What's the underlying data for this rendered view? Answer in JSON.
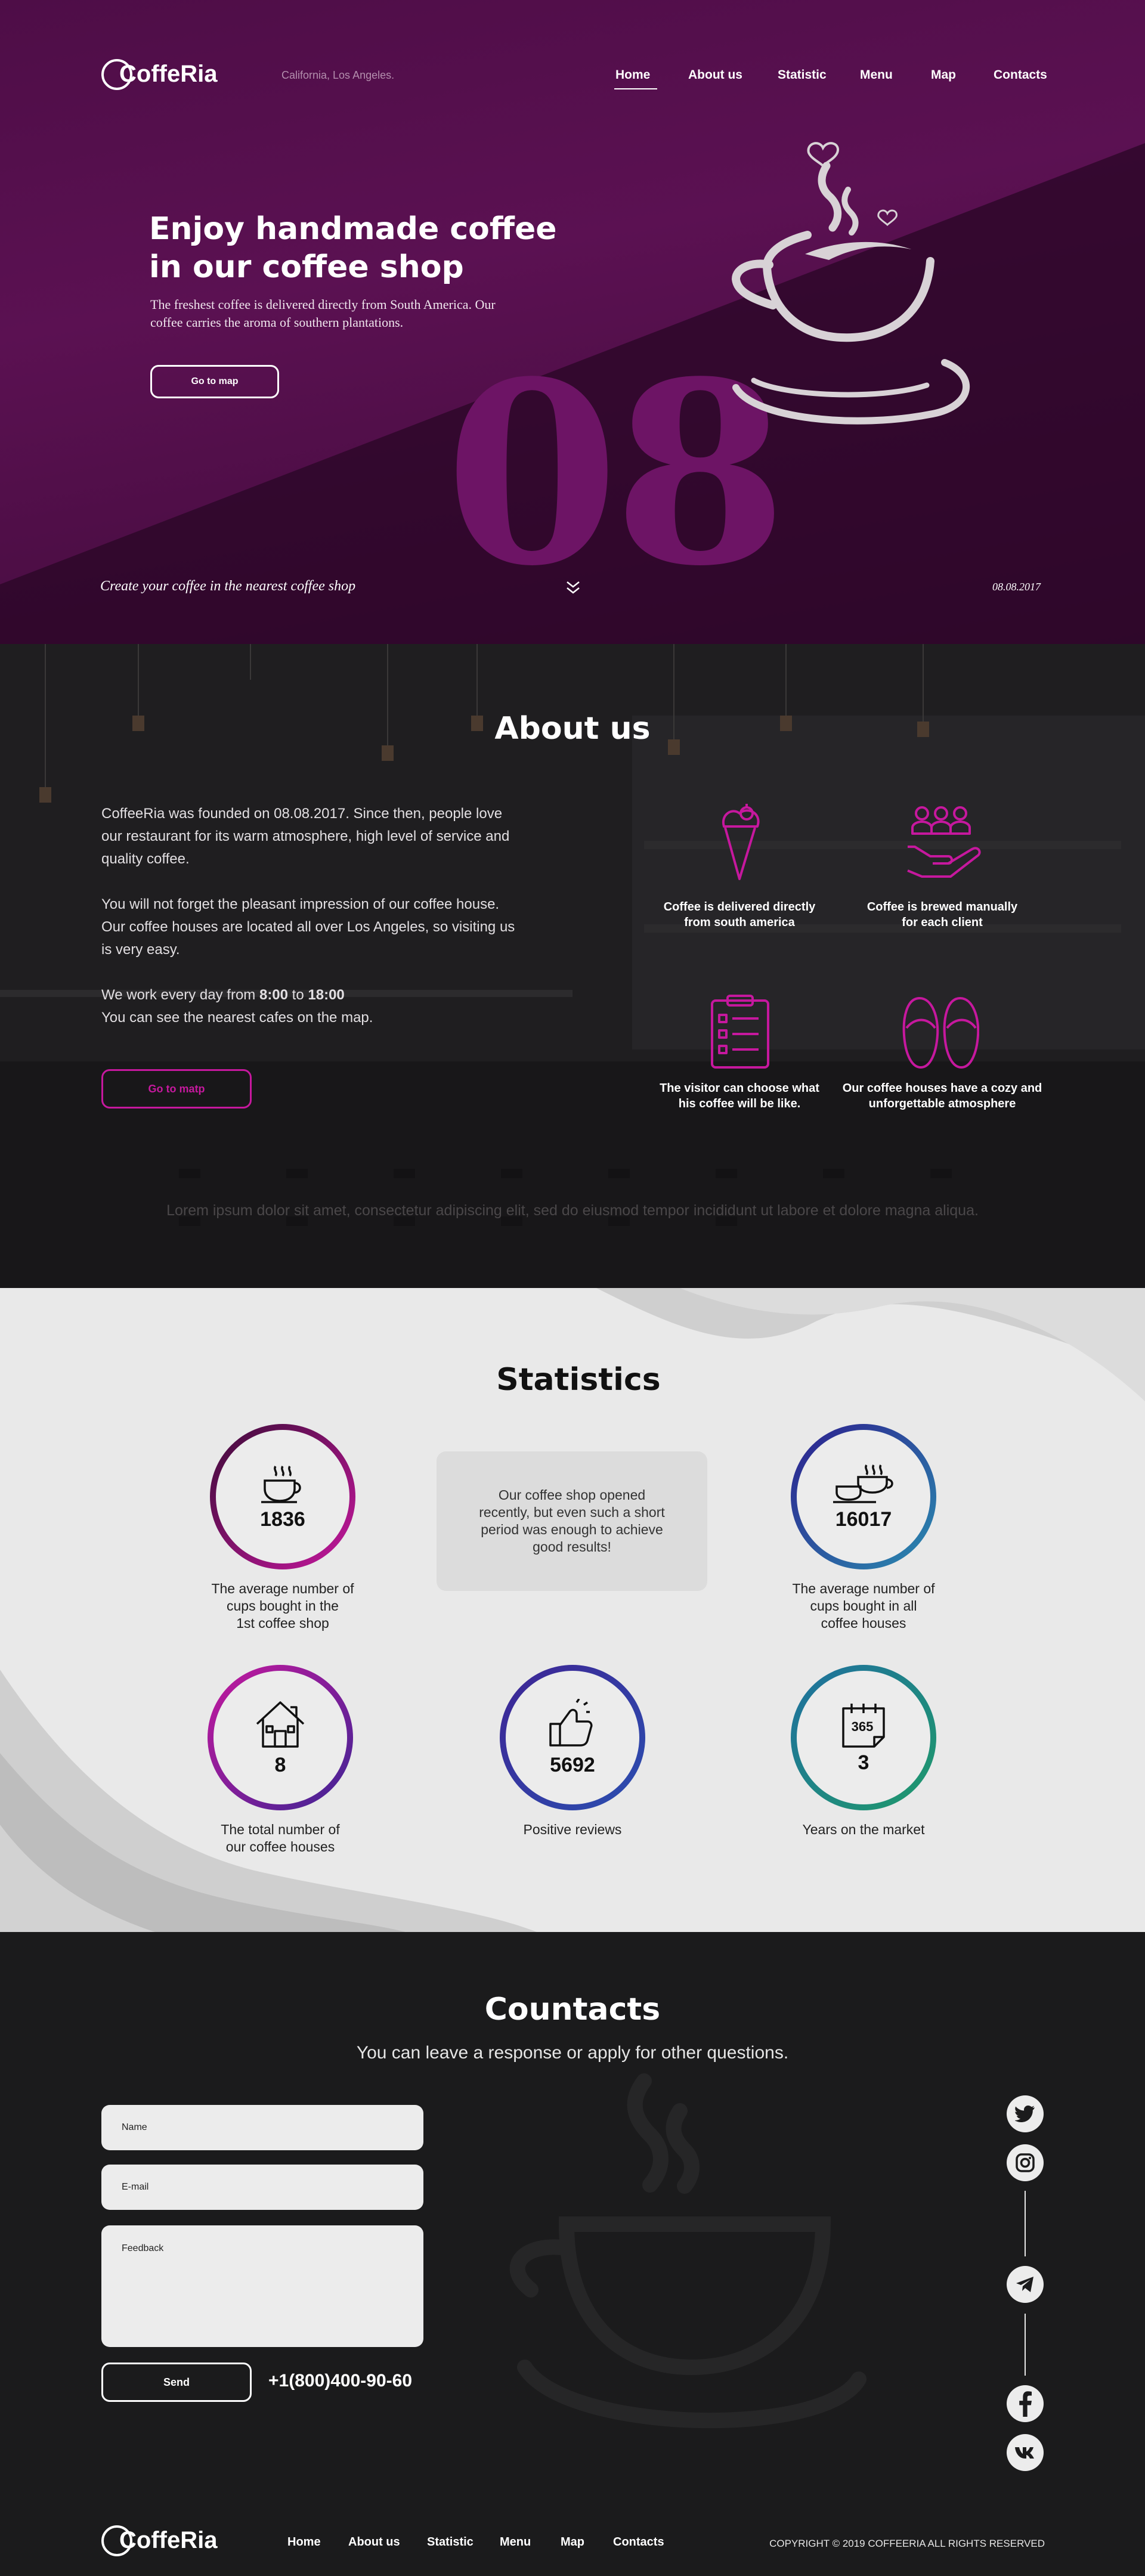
{
  "header": {
    "logo": "CoffeRia",
    "location": "California, Los Angeles.",
    "nav": [
      "Home",
      "About us",
      "Statistic",
      "Menu",
      "Map",
      "Contacts"
    ]
  },
  "hero": {
    "title_line1": "Enjoy handmade coffee",
    "title_line2": "in our coffee shop",
    "subtitle_line1": "The freshest coffee is delivered directly from South America. Our",
    "subtitle_line2": "coffee carries the aroma of southern plantations.",
    "button": "Go to map",
    "big_number": "08",
    "tagline": "Create your coffee in the nearest coffee shop",
    "date": "08.08.2017"
  },
  "about": {
    "title": "About us",
    "p1_line1": "CoffeeRia was founded on 08.08.2017. Since then, people love",
    "p1_line2": "our restaurant for its warm atmosphere, high level of service and",
    "p1_line3": "quality coffee.",
    "p2_line1": "You will not forget the pleasant impression of our coffee house.",
    "p2_line2": "Our coffee houses are located all over Los Angeles, so visiting us",
    "p2_line3": "is very easy.",
    "p3_prefix": "We work every day from ",
    "p3_open": "8:00",
    "p3_mid": " to ",
    "p3_close": "18:00",
    "p3_line2": "You can see the nearest cafes on the map.",
    "button": "Go to matp",
    "features": [
      {
        "line1": "Coffee is delivered directly",
        "line2": "from south america"
      },
      {
        "line1": "Coffee is brewed manually",
        "line2": "for each client"
      },
      {
        "line1": "The visitor can choose what",
        "line2": "his coffee will be like."
      },
      {
        "line1": "Our coffee houses have a cozy and",
        "line2": "unforgettable atmosphere"
      }
    ],
    "lorem": "Lorem ipsum dolor sit amet, consectetur adipiscing elit, sed do eiusmod tempor incididunt ut labore et dolore magna aliqua."
  },
  "stats": {
    "title": "Statistics",
    "items": [
      {
        "value": "1836",
        "cap1": "The average number of",
        "cap2": "cups bought in the",
        "cap3": "1st coffee shop"
      },
      {
        "value": "16017",
        "cap1": "The average number of",
        "cap2": "cups bought in all",
        "cap3": "coffee houses"
      },
      {
        "value": "8",
        "cap1": "The total number of",
        "cap2": "our coffee houses"
      },
      {
        "value": "5692",
        "cap1": "Positive reviews"
      },
      {
        "value": "3",
        "cap1": "Years on the market"
      }
    ],
    "box_line1": "Our coffee shop opened",
    "box_line2": "recently, but even such a short",
    "box_line3": "period was enough to achieve",
    "box_line4": "good results!",
    "calendar_label": "365"
  },
  "contacts": {
    "title": "Countacts",
    "subtitle": "You can leave a response or apply for other questions.",
    "name_placeholder": "Name",
    "email_placeholder": "E-mail",
    "feedback_placeholder": "Feedback",
    "send": "Send",
    "phone": "+1(800)400-90-60"
  },
  "footer": {
    "logo": "CoffeRia",
    "nav": [
      "Home",
      "About us",
      "Statistic",
      "Menu",
      "Map",
      "Contacts"
    ],
    "copyright": "COPYRIGHT © 2019 COFFEERIA ALL RIGHTS RESERVED"
  },
  "colors": {
    "hero_bg": "#5b1152",
    "accent_magenta": "#c6189e",
    "stats_bg": "#e9e9e9",
    "contacts_bg": "#1b1b1c"
  }
}
